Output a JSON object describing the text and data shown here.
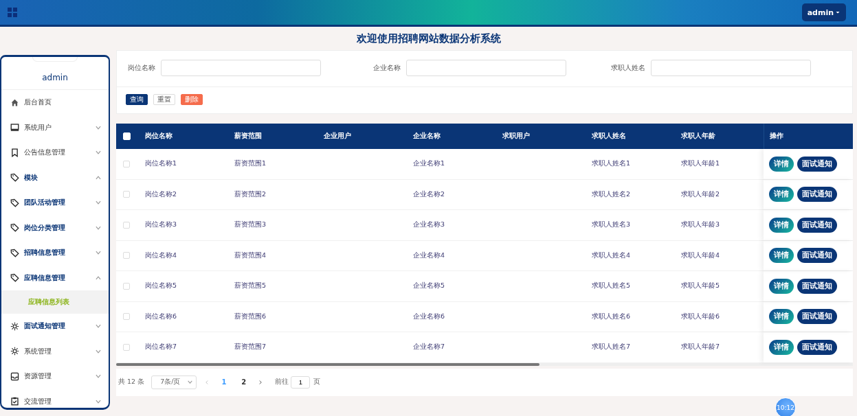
{
  "header": {
    "user_menu": "admin"
  },
  "page_title": "欢迎使用招聘网站数据分析系统",
  "sidebar": {
    "username": "admin",
    "items": [
      {
        "label": "后台首页",
        "kind": "home",
        "emphasized": false
      },
      {
        "label": "系统用户",
        "kind": "monitor",
        "emphasized": false,
        "expanded": false
      },
      {
        "label": "公告信息管理",
        "kind": "bookmark",
        "emphasized": false,
        "expanded": false
      },
      {
        "label": "模块",
        "kind": "tag",
        "emphasized": true,
        "expanded": true
      },
      {
        "label": "团队活动管理",
        "kind": "tag",
        "emphasized": true,
        "expanded": false
      },
      {
        "label": "岗位分类管理",
        "kind": "tag",
        "emphasized": true,
        "expanded": false
      },
      {
        "label": "招聘信息管理",
        "kind": "tag",
        "emphasized": true,
        "expanded": false
      },
      {
        "label": "应聘信息管理",
        "kind": "tag",
        "emphasized": true,
        "expanded": true,
        "children": [
          {
            "label": "应聘信息列表",
            "selected": true
          }
        ]
      },
      {
        "label": "面试通知管理",
        "kind": "sun",
        "emphasized": true,
        "expanded": false
      },
      {
        "label": "系统管理",
        "kind": "sun",
        "emphasized": false,
        "expanded": false
      },
      {
        "label": "资源管理",
        "kind": "inbox",
        "emphasized": false,
        "expanded": false
      },
      {
        "label": "交流管理",
        "kind": "clipboard",
        "emphasized": false,
        "expanded": false
      }
    ]
  },
  "search": {
    "fields": [
      {
        "label": "岗位名称"
      },
      {
        "label": "企业名称"
      },
      {
        "label": "求职人姓名"
      }
    ],
    "buttons": [
      {
        "label": "查询",
        "kind": "primary"
      },
      {
        "label": "重置",
        "kind": "plain"
      },
      {
        "label": "删除",
        "kind": "danger"
      }
    ]
  },
  "table": {
    "select_all_checked": false,
    "columns": [
      "岗位名称",
      "薪资范围",
      "企业用户",
      "企业名称",
      "求职用户",
      "求职人姓名",
      "求职人年龄",
      "操作"
    ],
    "rows": [
      {
        "checked": false,
        "cells": [
          "岗位名称1",
          "薪资范围1",
          "",
          "企业名称1",
          "",
          "求职人姓名1",
          "求职人年龄1"
        ],
        "actions": [
          "详情",
          "面试通知"
        ]
      },
      {
        "checked": false,
        "cells": [
          "岗位名称2",
          "薪资范围2",
          "",
          "企业名称2",
          "",
          "求职人姓名2",
          "求职人年龄2"
        ],
        "actions": [
          "详情",
          "面试通知"
        ]
      },
      {
        "checked": false,
        "cells": [
          "岗位名称3",
          "薪资范围3",
          "",
          "企业名称3",
          "",
          "求职人姓名3",
          "求职人年龄3"
        ],
        "actions": [
          "详情",
          "面试通知"
        ]
      },
      {
        "checked": false,
        "cells": [
          "岗位名称4",
          "薪资范围4",
          "",
          "企业名称4",
          "",
          "求职人姓名4",
          "求职人年龄4"
        ],
        "actions": [
          "详情",
          "面试通知"
        ]
      },
      {
        "checked": false,
        "cells": [
          "岗位名称5",
          "薪资范围5",
          "",
          "企业名称5",
          "",
          "求职人姓名5",
          "求职人年龄5"
        ],
        "actions": [
          "详情",
          "面试通知"
        ]
      },
      {
        "checked": false,
        "cells": [
          "岗位名称6",
          "薪资范围6",
          "",
          "企业名称6",
          "",
          "求职人姓名6",
          "求职人年龄6"
        ],
        "actions": [
          "详情",
          "面试通知"
        ]
      },
      {
        "checked": false,
        "cells": [
          "岗位名称7",
          "薪资范围7",
          "",
          "企业名称7",
          "",
          "求职人姓名7",
          "求职人年龄7"
        ],
        "actions": [
          "详情",
          "面试通知"
        ]
      }
    ]
  },
  "pagination": {
    "total": "共 12 条",
    "page_size": "7条/页",
    "pages": [
      {
        "label": "1",
        "selected": true
      },
      {
        "label": "2",
        "selected": false
      }
    ],
    "goto_label": "前往",
    "goto_value": "1",
    "goto_suffix": "页"
  },
  "clock": "10:12"
}
